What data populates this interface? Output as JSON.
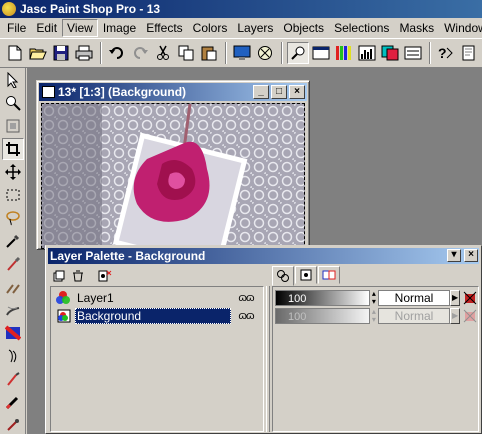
{
  "app": {
    "title": "Jasc Paint Shop Pro - 13"
  },
  "menu": [
    "File",
    "Edit",
    "View",
    "Image",
    "Effects",
    "Colors",
    "Layers",
    "Objects",
    "Selections",
    "Masks",
    "Window",
    "He"
  ],
  "menu_active": "View",
  "image_window": {
    "title": "13* [1:3] (Background)"
  },
  "layer_palette": {
    "title": "Layer Palette - Background",
    "layers": [
      {
        "name": "Layer1",
        "opacity": "100",
        "blend": "Normal"
      },
      {
        "name": "Background",
        "opacity": "100",
        "blend": "Normal"
      }
    ]
  },
  "colors": {
    "title_bar": "#0a246a",
    "selection": "#0a246a",
    "face": "#d4d0c8",
    "workspace": "#808080"
  }
}
